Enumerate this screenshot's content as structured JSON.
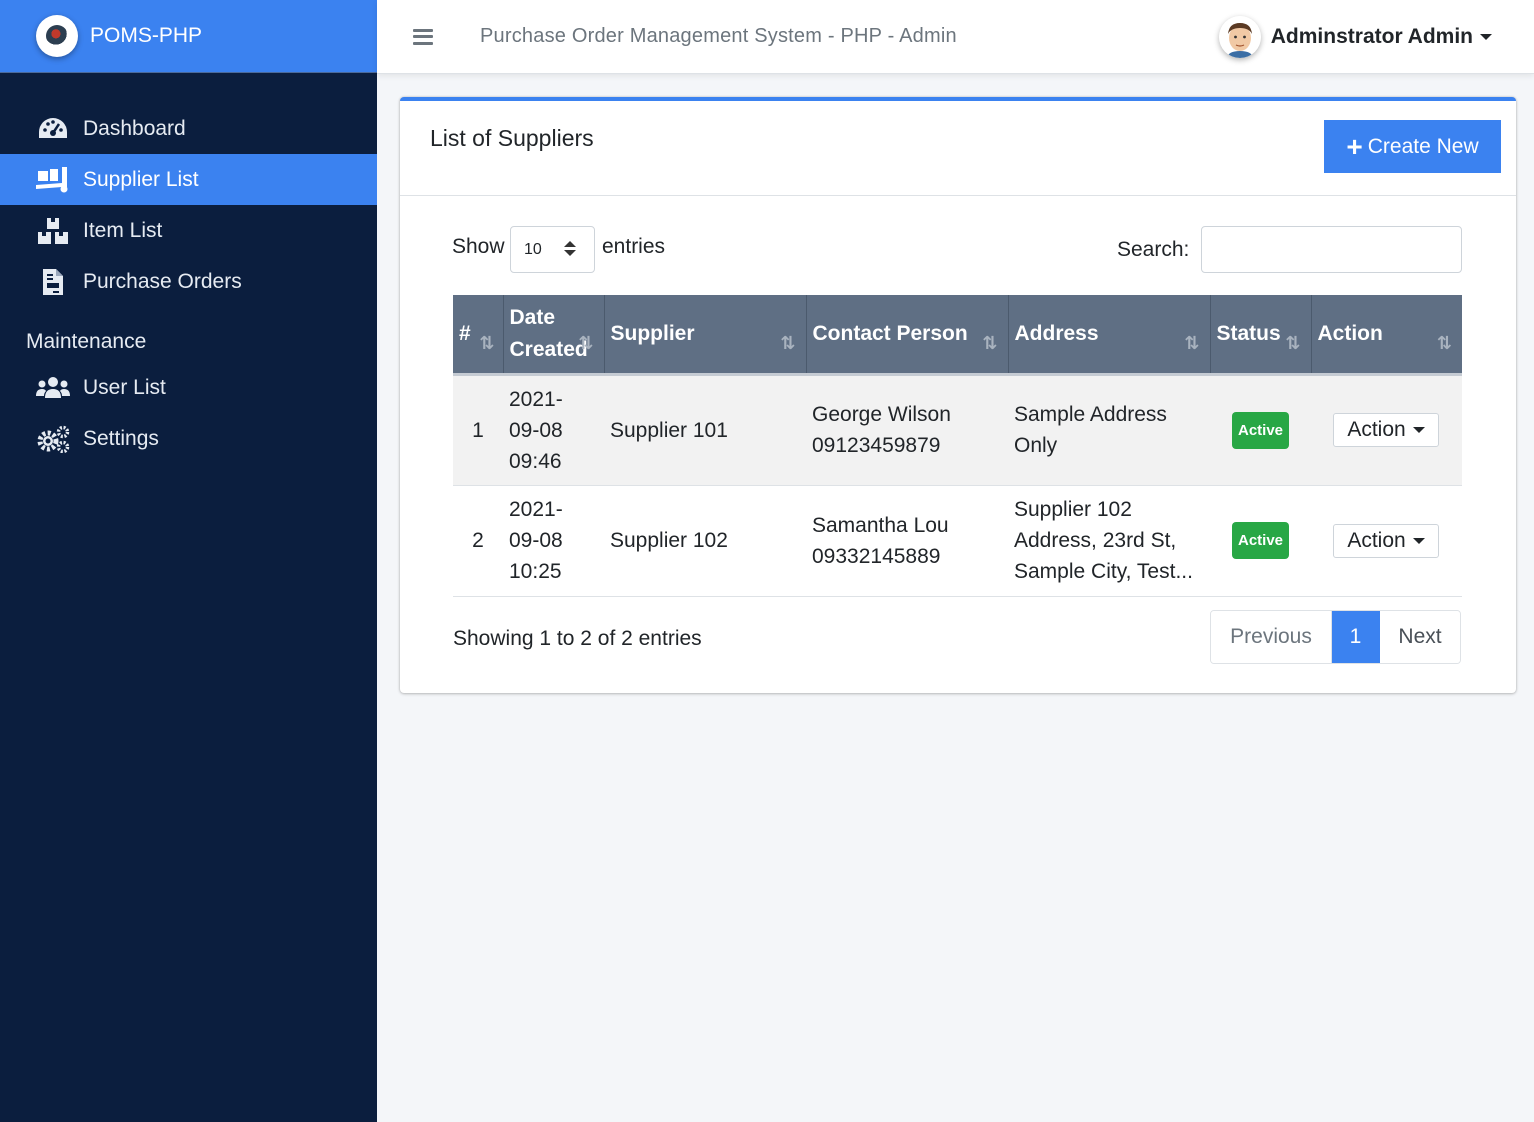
{
  "brand": {
    "name": "POMS-PHP"
  },
  "sidebar": {
    "items": [
      {
        "label": "Dashboard",
        "icon": "tachometer-icon"
      },
      {
        "label": "Supplier List",
        "icon": "truck-loading-icon",
        "active": true
      },
      {
        "label": "Item List",
        "icon": "boxes-icon"
      },
      {
        "label": "Purchase Orders",
        "icon": "file-invoice-icon"
      }
    ],
    "section_header": "Maintenance",
    "maintenance_items": [
      {
        "label": "User List",
        "icon": "users-icon"
      },
      {
        "label": "Settings",
        "icon": "cogs-icon"
      }
    ]
  },
  "topbar": {
    "title": "Purchase Order Management System - PHP - Admin",
    "user_name": "Adminstrator Admin"
  },
  "card": {
    "title": "List of Suppliers",
    "create_label": "Create New"
  },
  "table_controls": {
    "show_label": "Show",
    "entries_value": "10",
    "entries_label": "entries",
    "search_label": "Search:"
  },
  "table": {
    "columns": [
      "#",
      "Date Created",
      "Supplier",
      "Contact Person",
      "Address",
      "Status",
      "Action"
    ],
    "rows": [
      {
        "num": "1",
        "date_line1": "2021-",
        "date_line2": "09-08",
        "date_line3": "09:46",
        "supplier": "Supplier 101",
        "contact_name": "George Wilson",
        "contact_phone": "09123459879",
        "address": "Sample Address Only",
        "status": "Active",
        "action": "Action"
      },
      {
        "num": "2",
        "date_line1": "2021-",
        "date_line2": "09-08",
        "date_line3": "10:25",
        "supplier": "Supplier 102",
        "contact_name": "Samantha Lou",
        "contact_phone": "09332145889",
        "address": "Supplier 102 Address, 23rd St, Sample City, Test...",
        "status": "Active",
        "action": "Action"
      }
    ]
  },
  "footer": {
    "info": "Showing 1 to 2 of 2 entries",
    "prev": "Previous",
    "current_page": "1",
    "next": "Next"
  },
  "colors": {
    "primary": "#3b82f0",
    "sidebar_bg": "#0b1e3e",
    "header_bg": "#5f6f84",
    "success": "#28a745"
  }
}
